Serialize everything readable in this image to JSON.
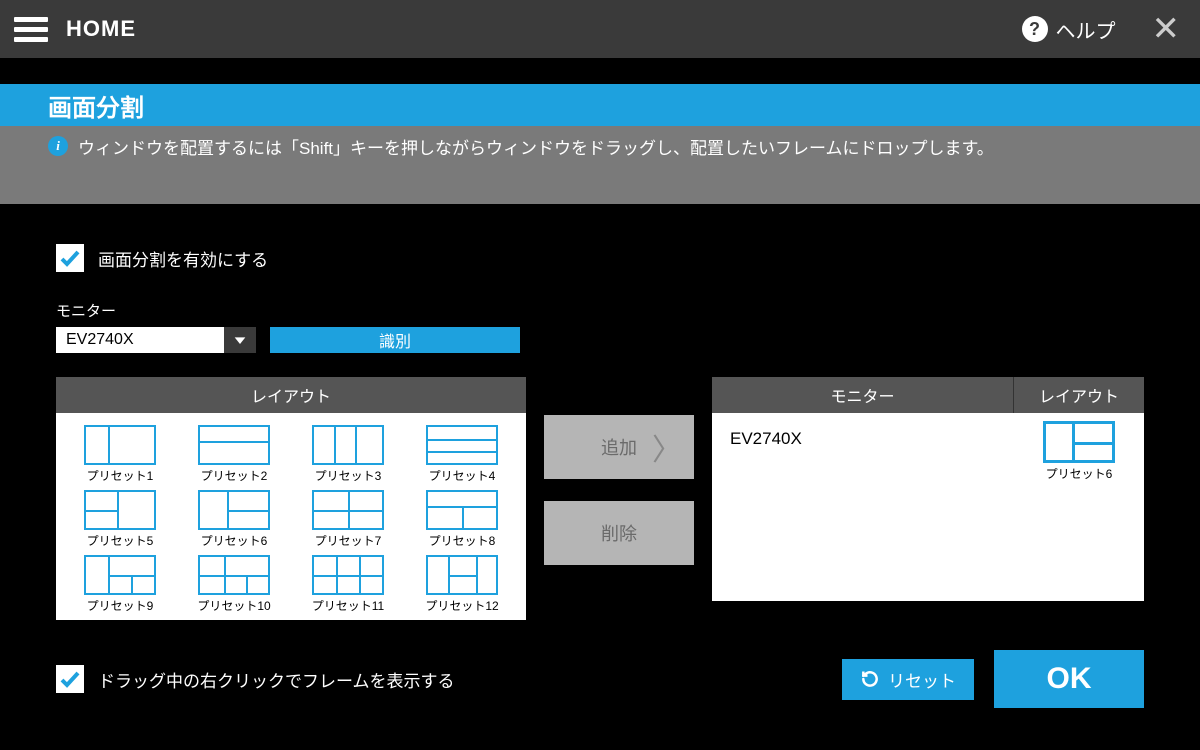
{
  "topbar": {
    "home": "HOME",
    "help": "ヘルプ"
  },
  "title": "画面分割",
  "info": "ウィンドウを配置するには「Shift」キーを押しながらウィンドウをドラッグし、配置したいフレームにドロップします。",
  "enable_label": "画面分割を有効にする",
  "monitor_label": "モニター",
  "monitor_value": "EV2740X",
  "identify": "識別",
  "layout_header": "レイアウト",
  "presets": [
    {
      "label": "プリセット1"
    },
    {
      "label": "プリセット2"
    },
    {
      "label": "プリセット3"
    },
    {
      "label": "プリセット4"
    },
    {
      "label": "プリセット5"
    },
    {
      "label": "プリセット6"
    },
    {
      "label": "プリセット7"
    },
    {
      "label": "プリセット8"
    },
    {
      "label": "プリセット9"
    },
    {
      "label": "プリセット10"
    },
    {
      "label": "プリセット11"
    },
    {
      "label": "プリセット12"
    }
  ],
  "add": "追加",
  "delete": "削除",
  "right_header_monitor": "モニター",
  "right_header_layout": "レイアウト",
  "assigned_monitor": "EV2740X",
  "assigned_preset_label": "プリセット6",
  "drag_label": "ドラッグ中の右クリックでフレームを表示する",
  "reset": "リセット",
  "ok": "OK"
}
